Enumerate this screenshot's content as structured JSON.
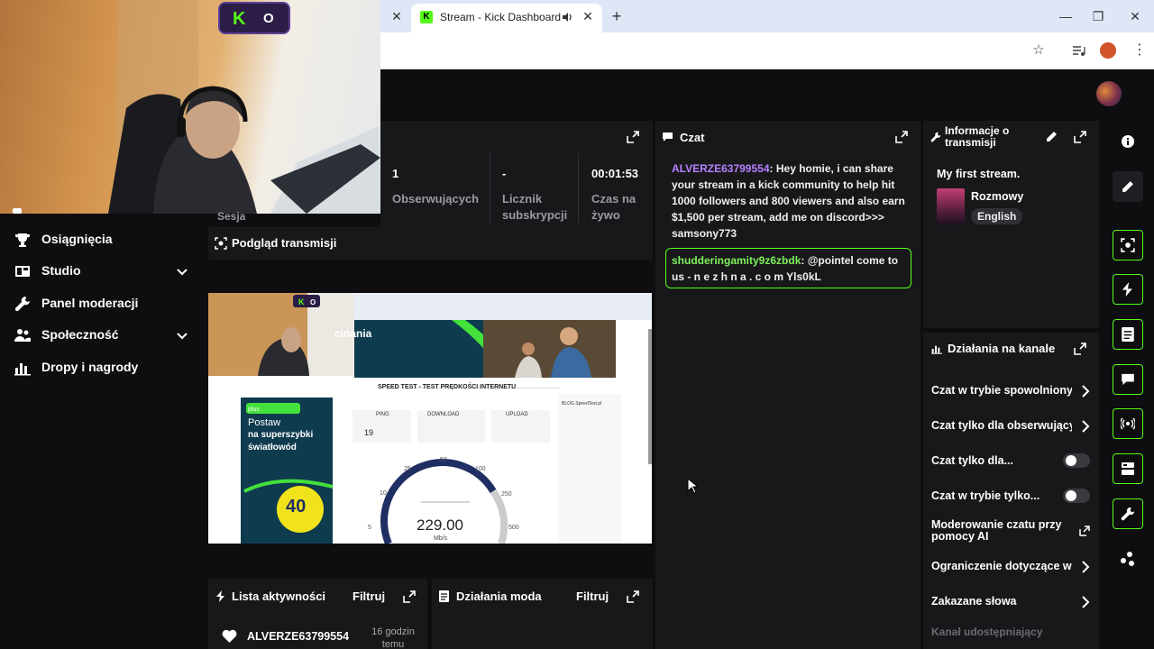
{
  "browser": {
    "tab_title": "Stream - Kick Dashboard",
    "tab_favicon": "K"
  },
  "webcam": {
    "badge_k": "K",
    "badge_o": "O"
  },
  "sidebar": {
    "partial_label": "Sesja",
    "items": [
      {
        "label": "Osiągnięcia",
        "icon": "trophy-icon",
        "expandable": false
      },
      {
        "label": "Studio",
        "icon": "studio-icon",
        "expandable": true
      },
      {
        "label": "Panel moderacji",
        "icon": "wrench-icon",
        "expandable": false
      },
      {
        "label": "Społeczność",
        "icon": "people-icon",
        "expandable": true
      },
      {
        "label": "Dropy i nagrody",
        "icon": "chart-icon",
        "expandable": false
      }
    ]
  },
  "stats": [
    {
      "value": "1",
      "label": "Obserwujących"
    },
    {
      "value": "-",
      "label": "Licznik subskrypcji"
    },
    {
      "value": "00:01:53",
      "label": "Czas na żywo"
    }
  ],
  "preview": {
    "title": "Podgląd transmisji",
    "speed": "229.00",
    "speed_unit": "Mb/s",
    "heading": "SPEED TEST - TEST PRĘDKOŚCI INTERNETU",
    "ping_label": "PING",
    "ping_value": "19",
    "download_label": "DOWNLOAD",
    "upload_label": "UPLOAD",
    "ad_line1": "Postaw",
    "ad_line2": "na superszybki",
    "ad_line3": "światłowód",
    "ad_number": "40",
    "banner_text": "cinania",
    "blog_title": "BLOG SpeedTest.pl",
    "gauge_ticks": [
      "5",
      "10",
      "25",
      "50",
      "100",
      "250",
      "500"
    ]
  },
  "chat": {
    "title": "Czat",
    "messages": [
      {
        "user": "ALVERZE63799554",
        "text": "Hey homie, i can share your stream in a kick community to help hit 1000 followers and 800 viewers and also earn $1,500 per stream, add me on discord>>> samsony773"
      },
      {
        "user": "shudderingamity9z6zbdk",
        "text": "@pointel come to us - n e z h n a . c o m Yls0kL"
      }
    ]
  },
  "stream_info": {
    "title": "Informacje o transmisji",
    "stream_title": "My first stream.",
    "category": "Rozmowy",
    "language": "English"
  },
  "channel_actions": {
    "title": "Działania na kanale",
    "items": [
      {
        "label": "Czat w trybie spowolnionym",
        "control": "chevron"
      },
      {
        "label": "Czat tylko dla obserwujących",
        "control": "chevron"
      },
      {
        "label": "Czat tylko dla...",
        "control": "toggle"
      },
      {
        "label": "Czat w trybie tylko...",
        "control": "toggle"
      },
      {
        "label": "Moderowanie czatu przy pomocy AI",
        "control": "external"
      },
      {
        "label": "Ograniczenie dotyczące wiadomości",
        "control": "chevron"
      },
      {
        "label": "Zakazane słowa",
        "control": "chevron"
      },
      {
        "label": "Kanał udostępniający",
        "control": "none"
      }
    ]
  },
  "activity": {
    "title": "Lista aktywności",
    "filter": "Filtruj",
    "items": [
      {
        "user": "ALVERZE63799554",
        "time": "16 godzin temu"
      }
    ]
  },
  "mod_actions": {
    "title": "Działania moda",
    "filter": "Filtruj"
  },
  "colors": {
    "accent": "#53fc18",
    "background": "#0e0e10",
    "panel": "#18181b"
  }
}
